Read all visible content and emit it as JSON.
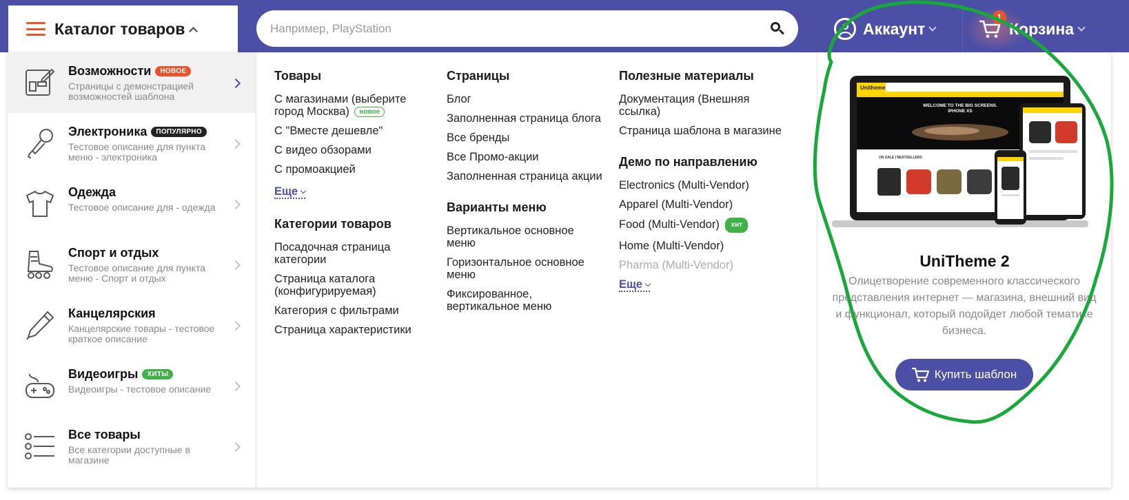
{
  "colors": {
    "brand": "#4b4fa6",
    "accent": "#e8532b",
    "green": "#3eb249",
    "annotation": "#19a83a"
  },
  "header": {
    "catalog_label": "Каталог товаров",
    "search_placeholder": "Например, PlayStation",
    "account_label": "Аккаунт",
    "cart_label": "Корзина",
    "cart_count": "1"
  },
  "categories": [
    {
      "title": "Возможности",
      "badge": "новое",
      "desc": "Страницы с демонстрацией возможностей шаблона",
      "icon": "layout-icon"
    },
    {
      "title": "Электроника",
      "badge": "популярно",
      "desc": "Тестовое описание для пункта меню - электроника",
      "icon": "microphone-icon"
    },
    {
      "title": "Одежда",
      "badge": "",
      "desc": "Тестовое описание для - одежда",
      "icon": "tshirt-icon"
    },
    {
      "title": "Спорт и отдых",
      "badge": "",
      "desc": "Тестовое описание для пункта меню - Спорт и отдых",
      "icon": "rollerskate-icon"
    },
    {
      "title": "Канцелярския",
      "badge": "",
      "desc": "Канцелярские товары - тестовое краткое описание",
      "icon": "pen-icon"
    },
    {
      "title": "Видеоигры",
      "badge": "хиты",
      "desc": "Видеоигры - тестовое описание",
      "icon": "gamepad-icon"
    },
    {
      "title": "Все товары",
      "badge": "",
      "desc": "Все категории доступные в магазине",
      "icon": "list-icon"
    }
  ],
  "columns": {
    "col1": {
      "title": "Товары",
      "links": [
        "С магазинами (выберите город Москва)",
        "С \"Вместе дешевле\"",
        "С видео обзорами",
        "С промоакцией"
      ],
      "link0_badge": "новое",
      "more": "Еще",
      "title2": "Категории товаров",
      "links2": [
        "Посадочная страница категории",
        "Страница каталога (конфигурируемая)",
        "Категория с фильтрами",
        "Страница характеристики"
      ]
    },
    "col2": {
      "title": "Страницы",
      "links": [
        "Блог",
        "Заполненная страница блога",
        "Все бренды",
        "Все Промо-акции",
        "Заполненная страница акции"
      ],
      "title2": "Варианты меню",
      "links2": [
        "Вертикальное основное меню",
        "Горизонтальное основное меню",
        "Фиксированное, вертикальное меню"
      ]
    },
    "col3": {
      "title": "Полезные материалы",
      "links": [
        "Документация (Внешняя ссылка)",
        "Страница шаблона в магазине"
      ],
      "title2": "Демо по направлению",
      "links2": [
        "Electronics (Multi-Vendor)",
        "Apparel (Multi-Vendor)",
        "Food (Multi-Vendor)",
        "Home (Multi-Vendor)",
        "Pharma (Multi-Vendor)"
      ],
      "food_badge": "хит",
      "more": "Еще"
    }
  },
  "promo": {
    "title": "UniTheme 2",
    "desc": "Олицетворение современного классического представления интернет — магазина, внешний вид и функционал, который подойдет любой тематике бизнеса.",
    "button": "Купить шаблон",
    "screen_logo": "Unitheme",
    "screen_headline_1": "WELCOME TO THE BIG SCREENS.",
    "screen_headline_2": "IPHONE XS",
    "screen_section": "ON SALE | BESTSELLERS"
  }
}
